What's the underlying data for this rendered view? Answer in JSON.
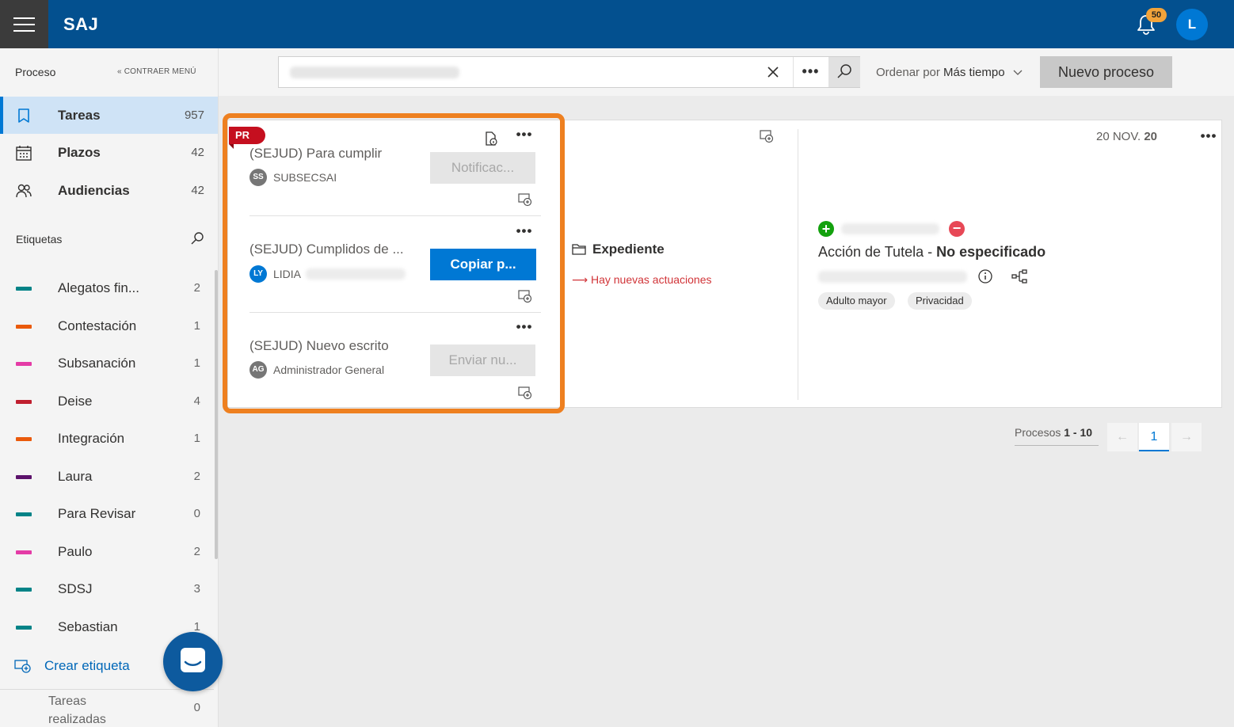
{
  "header": {
    "brand": "SAJ",
    "notifications_count": "50",
    "user_initial": "L"
  },
  "sidebar": {
    "section_title": "Proceso",
    "collapse_label": "« CONTRAER MENÚ",
    "nav": [
      {
        "label": "Tareas",
        "count": "957",
        "icon": "bookmark-icon",
        "active": true
      },
      {
        "label": "Plazos",
        "count": "42",
        "icon": "calendar-icon"
      },
      {
        "label": "Audiencias",
        "count": "42",
        "icon": "people-icon"
      }
    ],
    "tags_title": "Etiquetas",
    "tags": [
      {
        "label": "Alegatos fin...",
        "count": "2",
        "color": "#038387"
      },
      {
        "label": "Contestación",
        "count": "1",
        "color": "#ea5a0c"
      },
      {
        "label": "Subsanación",
        "count": "1",
        "color": "#e43ba6"
      },
      {
        "label": "Deise",
        "count": "4",
        "color": "#c01f2f"
      },
      {
        "label": "Integración",
        "count": "1",
        "color": "#ea5a0c"
      },
      {
        "label": "Laura",
        "count": "2",
        "color": "#5c126b"
      },
      {
        "label": "Para Revisar",
        "count": "0",
        "color": "#038387"
      },
      {
        "label": "Paulo",
        "count": "2",
        "color": "#e43ba6"
      },
      {
        "label": "SDSJ",
        "count": "3",
        "color": "#038387"
      },
      {
        "label": "Sebastian",
        "count": "1",
        "color": "#038387"
      }
    ],
    "create_tag": "Crear etiqueta",
    "done_tasks_label": "Tareas realizadas",
    "done_tasks_count": "0"
  },
  "toolbar": {
    "sort_prefix": "Ordenar por",
    "sort_value": "Más tiempo",
    "new_process": "Nuevo proceso",
    "more": "•••"
  },
  "process": {
    "badge": "PR",
    "tasks": [
      {
        "title": "(SEJUD) Para cumplir",
        "initials": "SS",
        "assignee": "SUBSECSAI",
        "action": "Notificac...",
        "avatar_color": "#767676",
        "primary": false
      },
      {
        "title": "(SEJUD) Cumplidos de ...",
        "initials": "LY",
        "assignee": "LIDIA",
        "action": "Copiar p...",
        "avatar_color": "#0078d4",
        "primary": true
      },
      {
        "title": "(SEJUD) Nuevo escrito",
        "initials": "AG",
        "assignee": "Administrador General",
        "action": "Enviar nu...",
        "avatar_color": "#767676",
        "primary": false
      }
    ],
    "expediente": "Expediente",
    "novedad": "⟶ Hay nuevas actuaciones",
    "date_prefix": "20 NOV.",
    "date_year": "20",
    "accion_prefix": "Acción de Tutela -",
    "accion_value": "No especificado",
    "chips": [
      "Adulto mayor",
      "Privacidad"
    ],
    "plus": "+",
    "minus": "−"
  },
  "pagination": {
    "label_prefix": "Procesos",
    "range": "1 - 10",
    "prev": "←",
    "current": "1",
    "next": "→"
  }
}
